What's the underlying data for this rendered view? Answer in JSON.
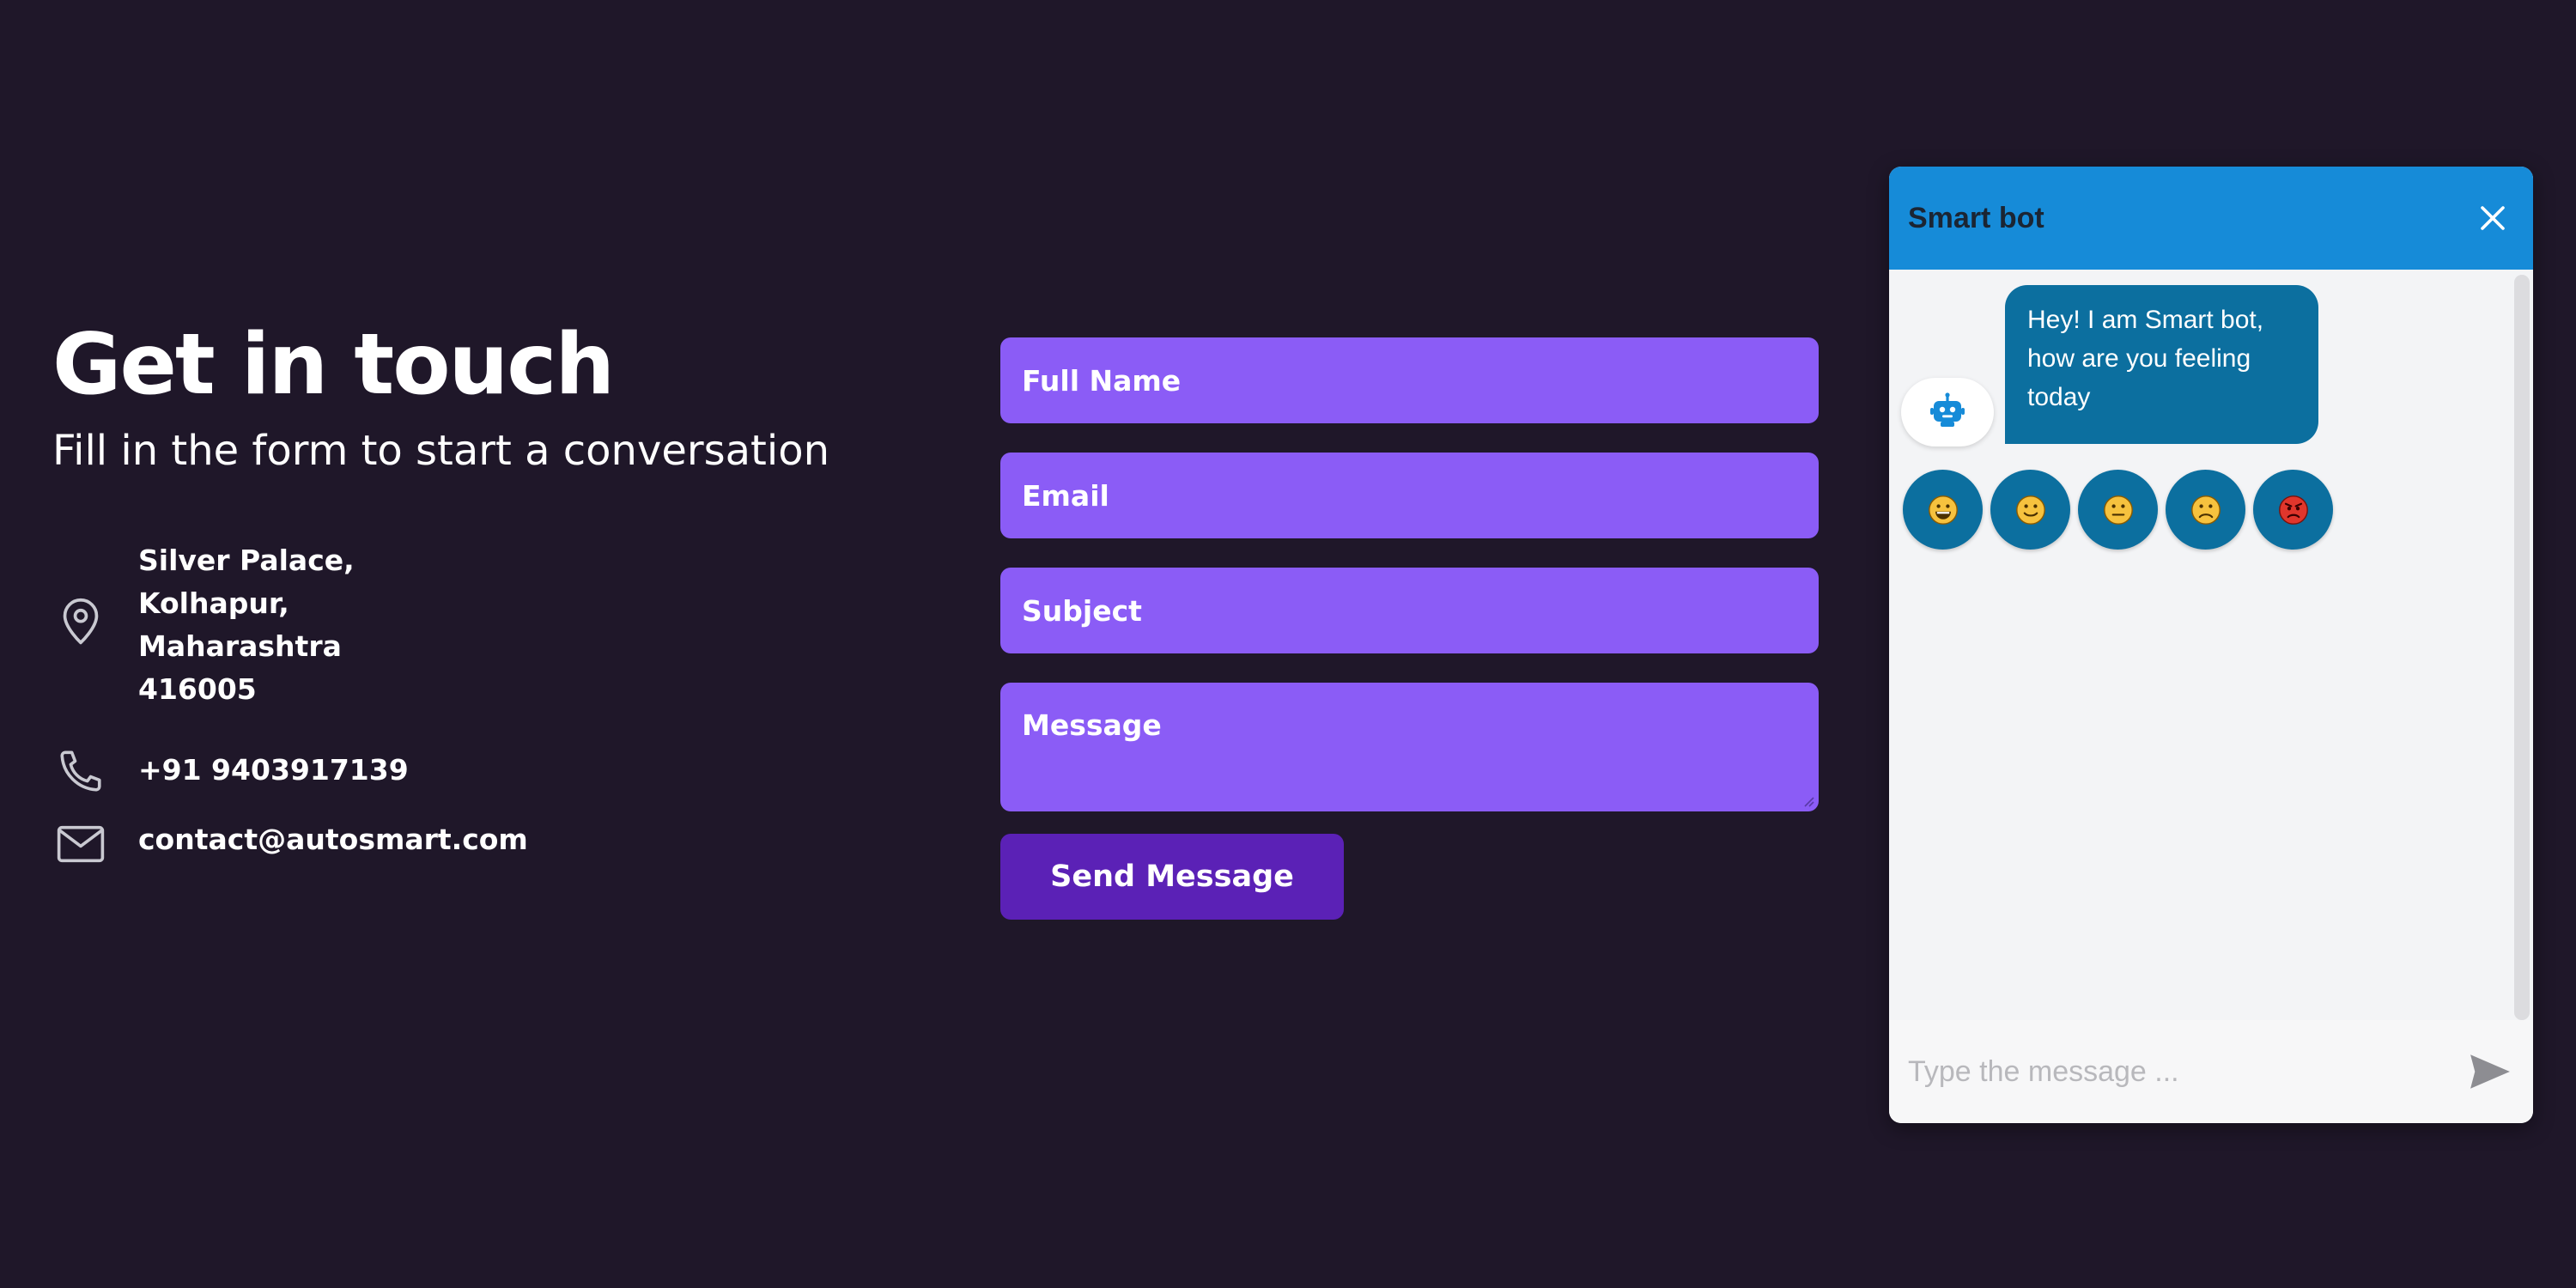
{
  "contact": {
    "title": "Get in touch",
    "subtitle": "Fill in the form to start a conversation",
    "address": "Silver Palace,\nKolhapur,\nMaharashtra\n416005",
    "phone": "+91 9403917139",
    "email": "contact@autosmart.com",
    "icons": [
      "location-pin-icon",
      "phone-icon",
      "mail-icon"
    ]
  },
  "form": {
    "full_name_placeholder": "Full Name",
    "email_placeholder": "Email",
    "subject_placeholder": "Subject",
    "message_placeholder": "Message",
    "send_label": "Send Message"
  },
  "chatbot": {
    "title": "Smart bot",
    "greeting": "Hey! I am Smart bot, how are you feeling today",
    "moods": [
      "grinning-face-icon",
      "slightly-smiling-face-icon",
      "neutral-face-icon",
      "frowning-face-icon",
      "angry-face-icon"
    ],
    "input_placeholder": "Type the message ..."
  },
  "colors": {
    "background": "#1f1729",
    "field": "#8b5cf6",
    "button": "#5b21b6",
    "chat_header": "#168bd8",
    "chat_bubble": "#0c6f9f"
  }
}
